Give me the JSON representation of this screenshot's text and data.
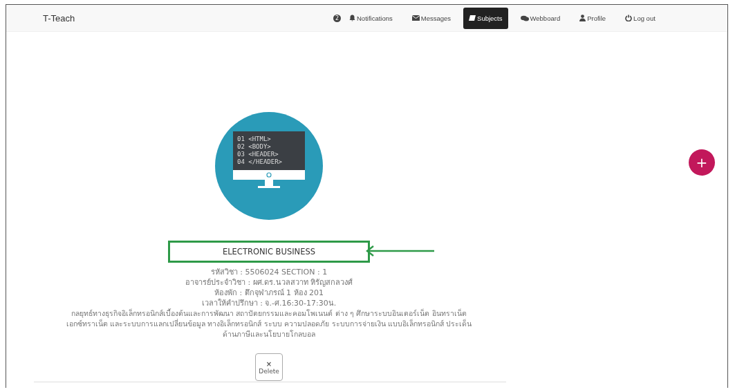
{
  "navbar": {
    "brand": "T-Teach",
    "notification_count": "2",
    "items": [
      {
        "label": "Notifications",
        "selected": false
      },
      {
        "label": "Messages",
        "selected": false
      },
      {
        "label": "Subjects",
        "selected": true
      },
      {
        "label": "Webboard",
        "selected": false
      },
      {
        "label": "Profile",
        "selected": false
      },
      {
        "label": "Log out",
        "selected": false
      }
    ]
  },
  "subject": {
    "image_code_lines": [
      "01 <HTML>",
      "02 <BODY>",
      "03 <HEADER>",
      "04 </HEADER>"
    ],
    "title": "ELECTRONIC BUSINESS",
    "highlighted": true,
    "details": [
      "รหัสวิชา : 5506024 SECTION : 1",
      "อาจารย์ประจำวิชา : ผศ.ดร.นวลสวาท หิรัญสกลวงศ์",
      "ห้องพัก : ตึกจุฬาภรณ์ 1 ห้อง 201",
      "เวลาให้คำปรึกษา : จ.-ศ.16:30-17:30น."
    ],
    "description": "กลยุทธ์ทางธุรกิจอิเล็กทรอนิกส์เบื้องต้นและการพัฒนา สถาปัตยกรรมและคอมโพเนนต์ ต่าง ๆ ศึกษาระบบอินเตอร์เน็ต อินทราเน็ต เอกซ์ทราเน็ต และระบบการแลกเปลี่ยนข้อมูล ทางอิเล็กทรอนิกส์ ระบบ ความปลอดภัย ระบบการจ่ายเงิน แบบอิเล็กทรอนิกส์ ประเด็น ด้านภาษีและนโยบายโกลบอล",
    "delete_button": {
      "icon": "×",
      "label": "Delete"
    }
  },
  "add_button": {
    "icon": "+"
  }
}
